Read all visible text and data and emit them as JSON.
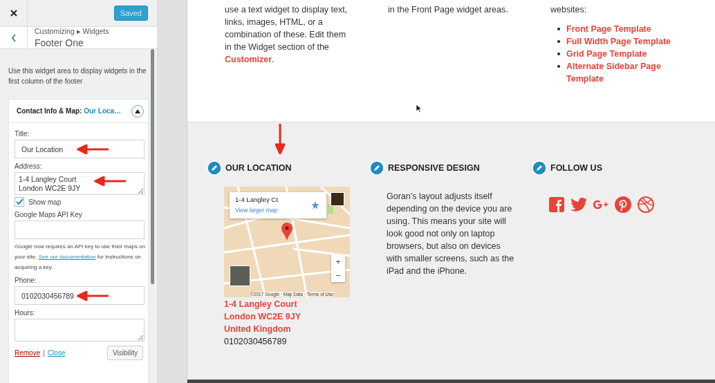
{
  "customizer": {
    "save_button": "Saved",
    "breadcrumb": "Customizing ▸ Widgets",
    "section_title": "Footer One",
    "description": "Use this widget area to display widgets in the first column of the footer",
    "widget": {
      "title": "Contact Info & Map:",
      "subtitle": "Our Loca…",
      "expanded": true,
      "fields": [
        {
          "kind": "text",
          "label": "Title:",
          "value": "Our Location",
          "annotated": true
        },
        {
          "kind": "textarea",
          "label": "Address:",
          "value": "1-4 Langley Court\nLondon WC2E 9JY",
          "annotated": true
        },
        {
          "kind": "checkbox",
          "label": "Show map",
          "checked": true
        },
        {
          "kind": "text",
          "label": "Google Maps API Key",
          "annotated": false
        },
        {
          "kind": "help",
          "text_before": "Google now requires an API key to use their maps on your site.",
          "link": "See our documentation",
          "text_after": "for instructions on acquiring a key."
        },
        {
          "kind": "text",
          "label": "Phone:",
          "value": "0102030456789",
          "annotated": true
        },
        {
          "kind": "textarea",
          "label": "Hours:",
          "annotated": false
        }
      ],
      "actions": {
        "remove": "Remove",
        "separator": "|",
        "close": "Close",
        "visibility": "Visibility"
      }
    }
  },
  "page": {
    "top_columns": [
      {
        "text": "use a text widget to display text, links, images, HTML, or a combination of these. Edit them in the Widget section of the",
        "link": "Customizer",
        "after": "."
      },
      {
        "text": "in the Front Page widget areas."
      },
      {
        "text": "websites:",
        "links": [
          "Front Page Template",
          "Full Width Page Template",
          "Grid Page Template",
          "Alternate Sidebar Page Template"
        ]
      }
    ],
    "footer_widgets": [
      {
        "kind": "location",
        "heading": "OUR LOCATION",
        "annotated": true,
        "map": {
          "card_title": "1-4 Langley Ct",
          "card_link": "View larger map",
          "zoom_in": "+",
          "zoom_out": "−",
          "attribution": "©2017 Google · Map Data · Terms of Use"
        },
        "address_lines": [
          "1-4 Langley Court",
          "London WC2E 9JY",
          "United Kingdom"
        ],
        "phone": "0102030456789"
      },
      {
        "kind": "text",
        "heading": "RESPONSIVE DESIGN",
        "annotated": false,
        "text": "Goran’s layout adjusts itself depending on the device you are using. This means your site will look good not only on laptop browsers, but also on devices with smaller screens, such as the iPad and the iPhone."
      },
      {
        "kind": "social",
        "heading": "FOLLOW US",
        "annotated": false
      }
    ]
  }
}
